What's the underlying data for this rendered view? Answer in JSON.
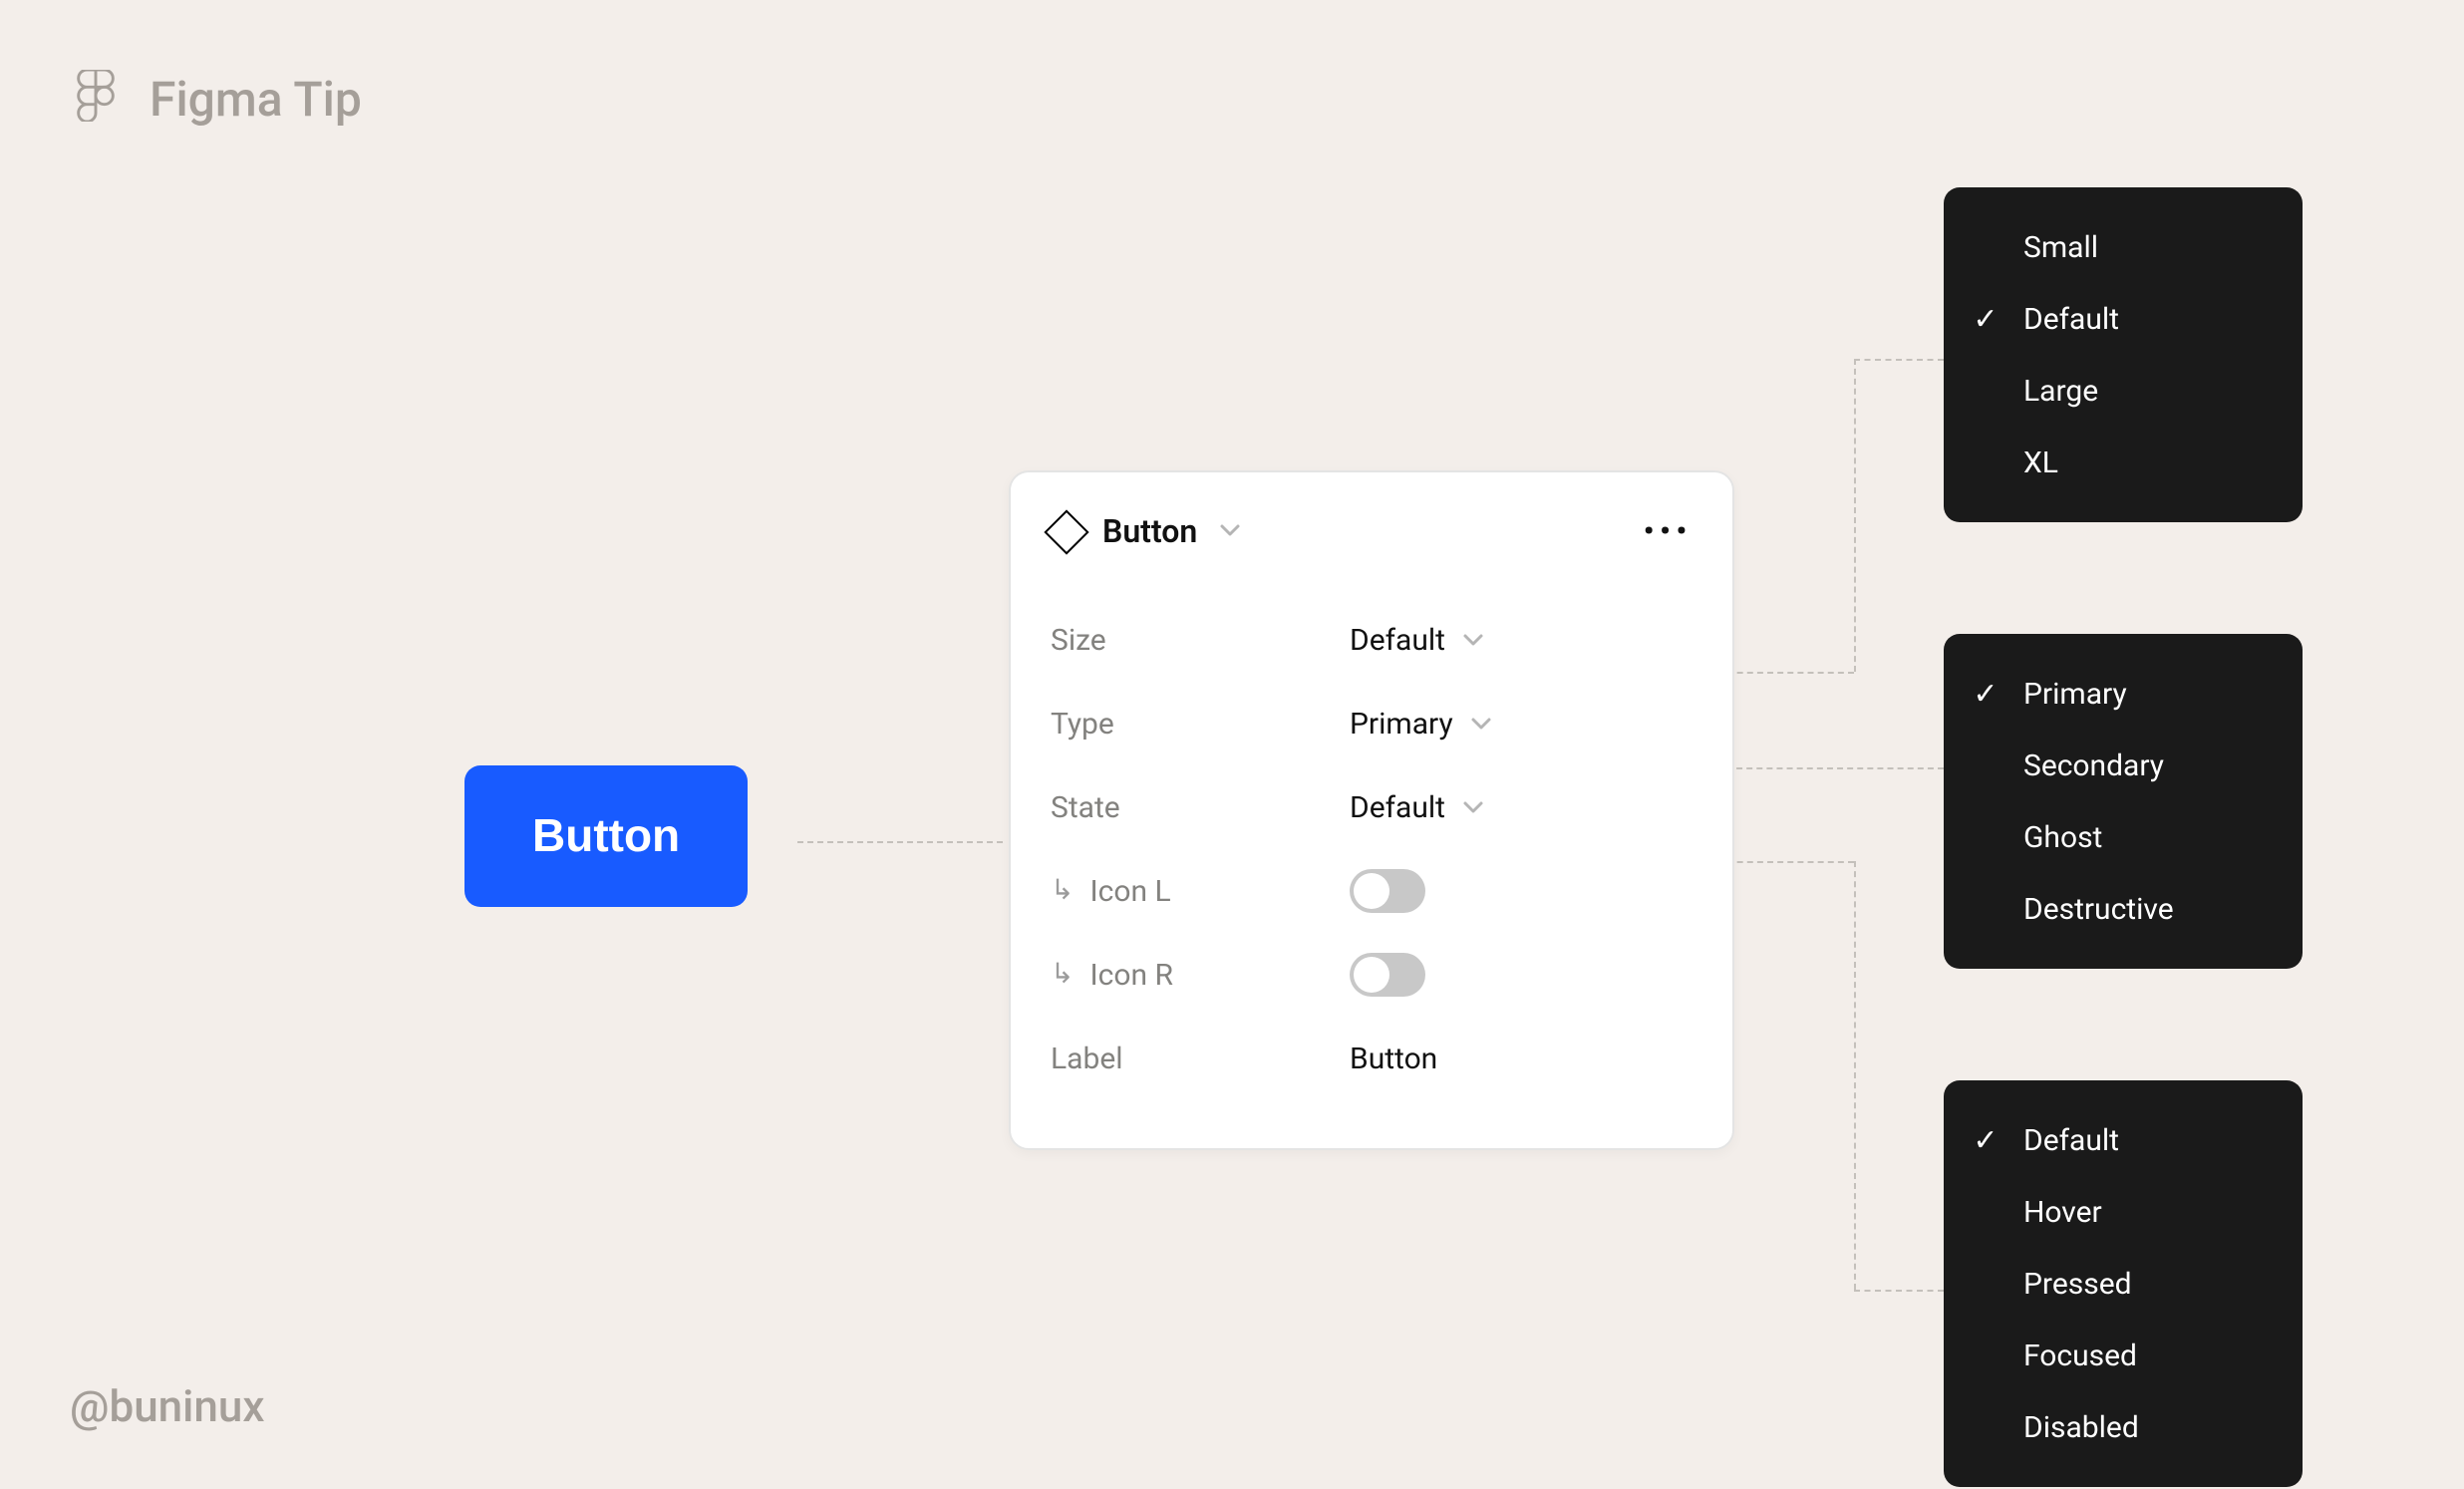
{
  "header": {
    "title": "Figma Tip"
  },
  "footer": {
    "handle": "@buninux"
  },
  "button": {
    "label": "Button"
  },
  "panel": {
    "title": "Button",
    "rows": {
      "size": {
        "label": "Size",
        "value": "Default"
      },
      "type": {
        "label": "Type",
        "value": "Primary"
      },
      "state": {
        "label": "State",
        "value": "Default"
      },
      "icon_l": {
        "label": "Icon L"
      },
      "icon_r": {
        "label": "Icon R"
      },
      "text": {
        "label": "Label",
        "value": "Button"
      }
    }
  },
  "menus": {
    "size": {
      "selected": "Default",
      "options": [
        "Small",
        "Default",
        "Large",
        "XL"
      ]
    },
    "type": {
      "selected": "Primary",
      "options": [
        "Primary",
        "Secondary",
        "Ghost",
        "Destructive"
      ]
    },
    "state": {
      "selected": "Default",
      "options": [
        "Default",
        "Hover",
        "Pressed",
        "Focused",
        "Disabled"
      ]
    }
  }
}
